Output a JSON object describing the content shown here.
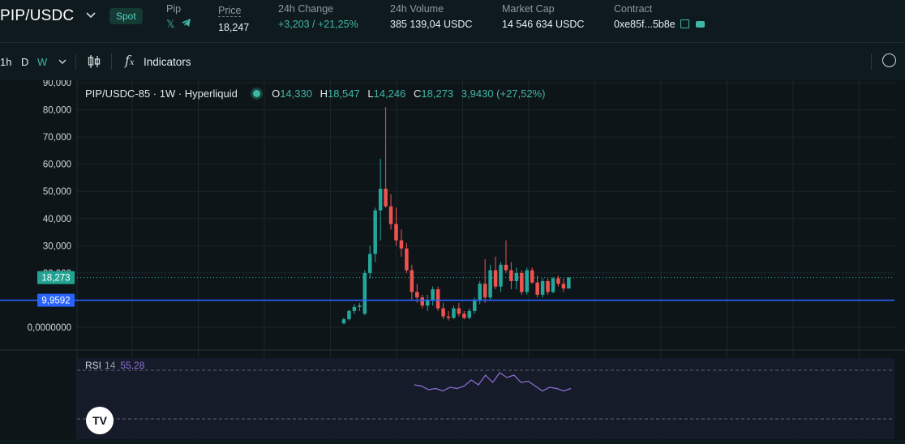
{
  "header": {
    "pair": "PIP/USDC",
    "market_type": "Spot",
    "token": {
      "label": "Pip"
    },
    "price": {
      "label": "Price",
      "value": "18,247"
    },
    "change": {
      "label": "24h Change",
      "value": "+3,203 / +21,25%"
    },
    "volume": {
      "label": "24h Volume",
      "value": "385 139,04 USDC"
    },
    "market_cap": {
      "label": "Market Cap",
      "value": "14 546 634 USDC"
    },
    "contract": {
      "label": "Contract",
      "value": "0xe85f...5b8e"
    }
  },
  "toolbar": {
    "intervals": [
      "1h",
      "D",
      "W"
    ],
    "active_interval": "W",
    "indicators_label": "Indicators"
  },
  "chart": {
    "legend": {
      "symbol": "PIP/USDC-85 · 1W · Hyperliquid",
      "o_label": "O",
      "o": "14,330",
      "h_label": "H",
      "h": "18,547",
      "l_label": "L",
      "l": "14,246",
      "c_label": "C",
      "c": "18,273",
      "change": "3,9430 (+27,52%)"
    },
    "price_tag": "18,273",
    "line_tag": "9,9592",
    "rsi": {
      "name": "RSI",
      "period": "14",
      "value": "55,28"
    },
    "tv_logo": "TV",
    "colors": {
      "up": "#26a69a",
      "down": "#ef5350",
      "line": "#2962ff",
      "rsi": "#8e70d6",
      "accent": "#3fb8a6"
    }
  },
  "chart_data": {
    "type": "candlestick",
    "y_ticks": [
      "90,000",
      "80,000",
      "70,000",
      "60,000",
      "50,000",
      "40,000",
      "30,000",
      "20,000",
      "0,0000000"
    ],
    "ylim": [
      0,
      90
    ],
    "grid": true,
    "horizontal_line": 9.9592,
    "last_close": 18.273,
    "candles": [
      [
        1.5,
        3.5,
        1.0,
        3.0
      ],
      [
        3.0,
        6.5,
        2.5,
        6.0
      ],
      [
        6.0,
        8.5,
        5.0,
        7.5
      ],
      [
        7.5,
        9.0,
        6.0,
        8.0
      ],
      [
        5.0,
        21.0,
        4.5,
        20.0
      ],
      [
        20.0,
        30.0,
        18.0,
        27.0
      ],
      [
        27.0,
        44.0,
        24.0,
        43.0
      ],
      [
        43.0,
        62.0,
        32.0,
        51.0
      ],
      [
        51.0,
        81.0,
        44.0,
        44.5
      ],
      [
        44.5,
        49.0,
        36.0,
        38.0
      ],
      [
        38.0,
        44.0,
        30.0,
        32.0
      ],
      [
        32.0,
        36.0,
        26.0,
        29.0
      ],
      [
        29.0,
        31.0,
        20.0,
        21.0
      ],
      [
        21.0,
        23.0,
        10.0,
        13.0
      ],
      [
        13.0,
        16.0,
        9.0,
        11.0
      ],
      [
        11.0,
        12.0,
        7.0,
        8.0
      ],
      [
        8.0,
        12.0,
        6.0,
        10.0
      ],
      [
        10.0,
        15.0,
        8.0,
        14.0
      ],
      [
        14.0,
        15.0,
        6.0,
        7.0
      ],
      [
        7.0,
        9.0,
        3.0,
        4.0
      ],
      [
        4.0,
        6.0,
        2.5,
        3.5
      ],
      [
        3.5,
        8.0,
        3.0,
        7.0
      ],
      [
        7.0,
        9.0,
        4.0,
        5.0
      ],
      [
        5.0,
        6.0,
        3.0,
        3.5
      ],
      [
        3.5,
        7.0,
        3.0,
        6.0
      ],
      [
        6.0,
        11.0,
        5.0,
        10.0
      ],
      [
        10.0,
        17.0,
        8.5,
        16.0
      ],
      [
        16.0,
        25.0,
        9.0,
        11.0
      ],
      [
        11.0,
        23.0,
        10.0,
        21.0
      ],
      [
        21.0,
        26.0,
        14.0,
        15.0
      ],
      [
        15.0,
        24.0,
        13.0,
        23.0
      ],
      [
        23.0,
        32.0,
        20.0,
        21.0
      ],
      [
        21.0,
        24.0,
        14.0,
        17.0
      ],
      [
        17.0,
        22.0,
        14.0,
        20.0
      ],
      [
        20.0,
        21.0,
        12.0,
        13.0
      ],
      [
        13.0,
        22.0,
        12.0,
        21.0
      ],
      [
        21.0,
        22.0,
        16.0,
        16.5
      ],
      [
        16.5,
        19.0,
        11.0,
        12.0
      ],
      [
        12.0,
        18.0,
        11.0,
        17.0
      ],
      [
        17.0,
        18.0,
        12.0,
        13.0
      ],
      [
        13.0,
        18.5,
        12.5,
        18.0
      ],
      [
        18.0,
        19.0,
        15.0,
        16.0
      ],
      [
        16.0,
        18.0,
        13.0,
        14.3
      ],
      [
        14.3,
        18.5,
        14.2,
        18.3
      ]
    ],
    "rsi": [
      58,
      57,
      54,
      55,
      53,
      56,
      55,
      57,
      62,
      58,
      66,
      60,
      68,
      64,
      66,
      60,
      61,
      57,
      53,
      56,
      55,
      53,
      55
    ]
  }
}
